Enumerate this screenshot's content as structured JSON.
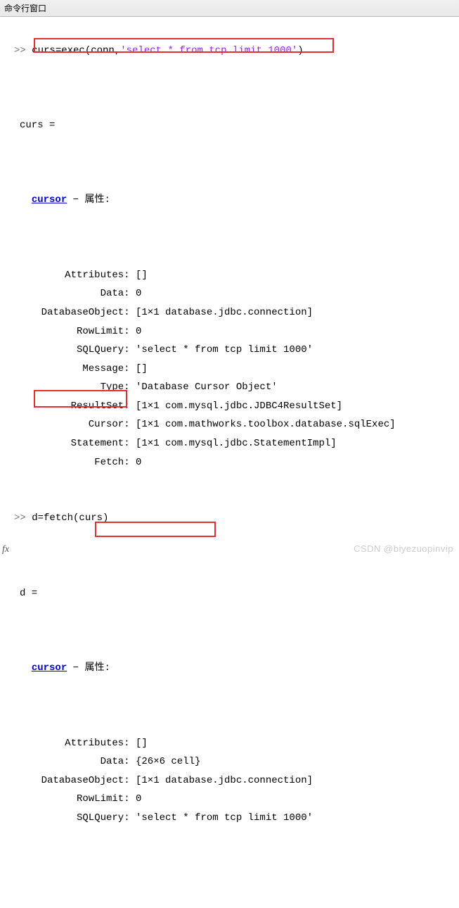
{
  "title_bar": "命令行窗口",
  "cmd1_pre": "curs=exec(conn,",
  "cmd1_str": "'select * from tcp limit 1000'",
  "cmd1_post": ")",
  "result1_var": "curs =",
  "cursor_link": "cursor",
  "props_label": " − 属性:",
  "r1": {
    "Attributes": "[]",
    "Data": "0",
    "DatabaseObject": "[1×1 database.jdbc.connection]",
    "RowLimit": "0",
    "SQLQuery": "'select * from tcp limit 1000'",
    "Message": "[]",
    "Type": "'Database Cursor Object'",
    "ResultSet": "[1×1 com.mysql.jdbc.JDBC4ResultSet]",
    "Cursor": "[1×1 com.mathworks.toolbox.database.sqlExec]",
    "Statement": "[1×1 com.mysql.jdbc.StatementImpl]",
    "Fetch": "0"
  },
  "cmd2": "d=fetch(curs)",
  "result2_var": "d =",
  "r2": {
    "Attributes": "[]",
    "Data": "{26×6 cell}",
    "DatabaseObject": "[1×1 database.jdbc.connection]",
    "RowLimit": "0",
    "SQLQuery": "'select * from tcp limit 1000'"
  },
  "prompt": ">> ",
  "fx": "fx",
  "watermark": "CSDN @biyezuopinvip"
}
